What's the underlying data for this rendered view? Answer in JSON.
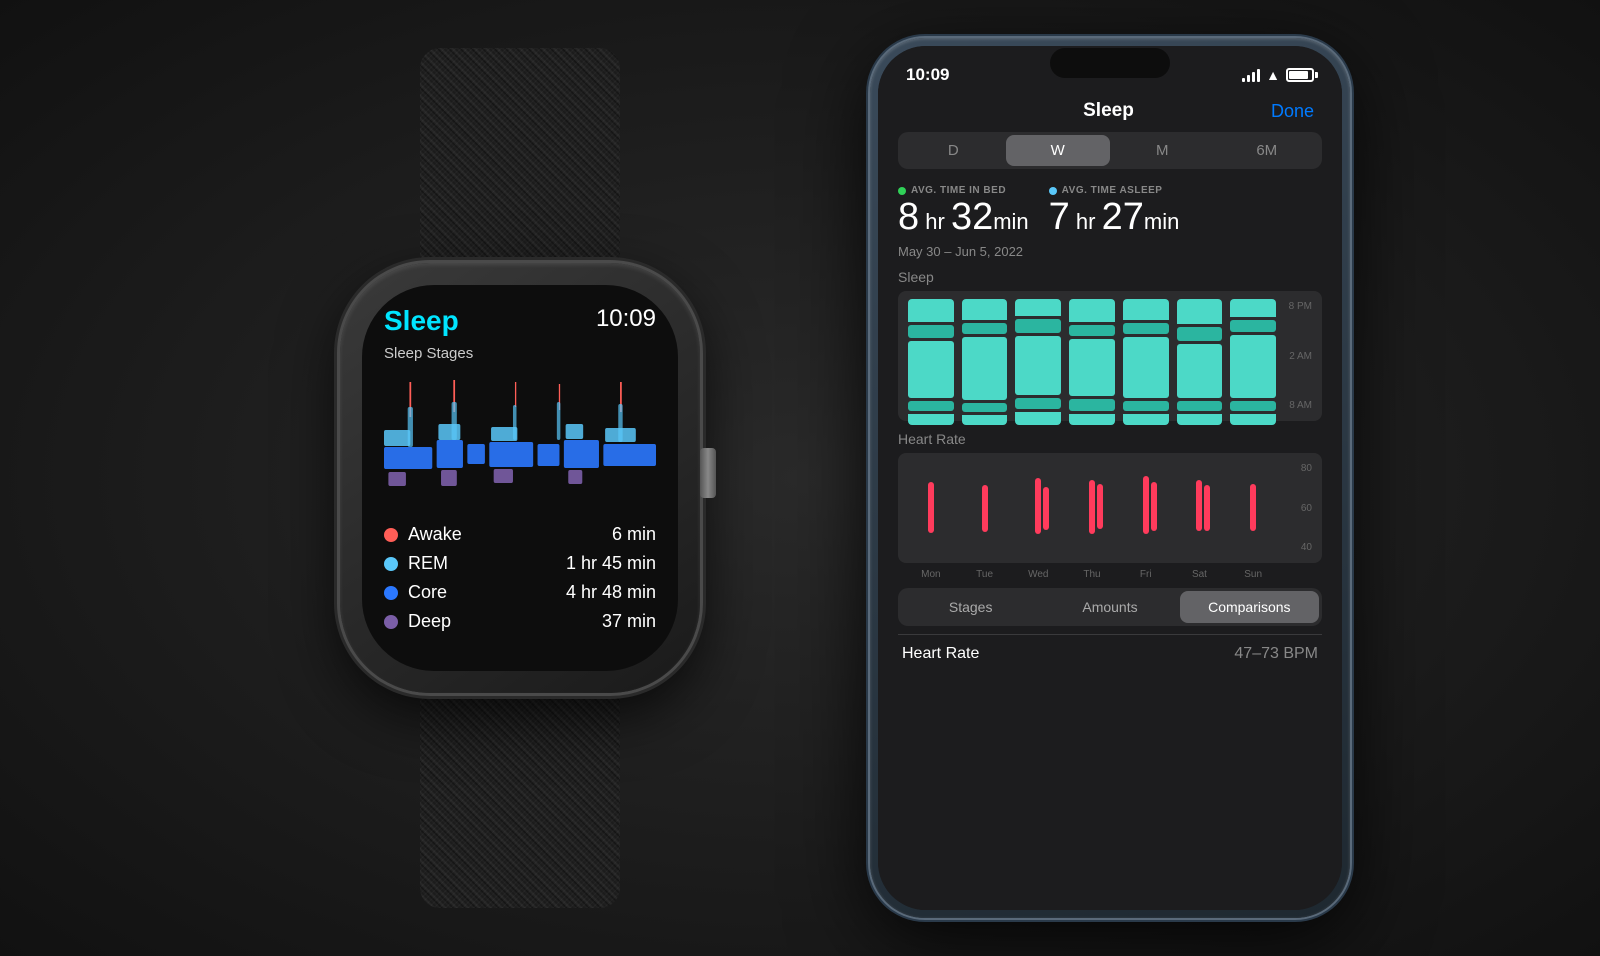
{
  "watch": {
    "title": "Sleep",
    "time": "10:09",
    "subtitle": "Sleep Stages",
    "stages": [
      {
        "name": "Awake",
        "duration": "6 min",
        "color": "#ff5e57",
        "dot_color": "#ff5e57"
      },
      {
        "name": "REM",
        "duration": "1 hr 45 min",
        "color": "#5ac8fa",
        "dot_color": "#5ac8fa"
      },
      {
        "name": "Core",
        "duration": "4 hr 48 min",
        "color": "#2b78ff",
        "dot_color": "#2b78ff"
      },
      {
        "name": "Deep",
        "duration": "37 min",
        "color": "#7b5ea7",
        "dot_color": "#7b5ea7"
      }
    ]
  },
  "phone": {
    "status_bar": {
      "time": "10:09",
      "done_label": "Done"
    },
    "nav": {
      "title": "Sleep",
      "done": "Done"
    },
    "periods": [
      "D",
      "W",
      "M",
      "6M"
    ],
    "active_period": "W",
    "stats": {
      "time_in_bed": {
        "label": "AVG. TIME IN BED",
        "hours": "8",
        "unit_hr": "hr",
        "minutes": "32",
        "unit_min": "min",
        "dot_color": "#30d158"
      },
      "time_asleep": {
        "label": "AVG. TIME ASLEEP",
        "hours": "7",
        "unit_hr": "hr",
        "minutes": "27",
        "unit_min": "min",
        "dot_color": "#5ac8fa"
      }
    },
    "date_range": "May 30 – Jun 5, 2022",
    "sleep_section_label": "Sleep",
    "chart_y_labels": [
      "8 PM",
      "2 AM",
      "8 AM"
    ],
    "days": [
      "Mon",
      "Tue",
      "Wed",
      "Thu",
      "Fri",
      "Sat",
      "Sun"
    ],
    "heart_rate_section_label": "Heart Rate",
    "hr_y_labels": [
      "80",
      "60",
      "40"
    ],
    "tabs": [
      "Stages",
      "Amounts",
      "Comparisons"
    ],
    "active_tab": "Comparisons",
    "bottom_stat": {
      "label": "Heart Rate",
      "value": "47–73 BPM"
    },
    "colors": {
      "teal": "#4cd9c7",
      "teal_dark": "#2bb5a0",
      "red": "#ff3b5c"
    }
  }
}
